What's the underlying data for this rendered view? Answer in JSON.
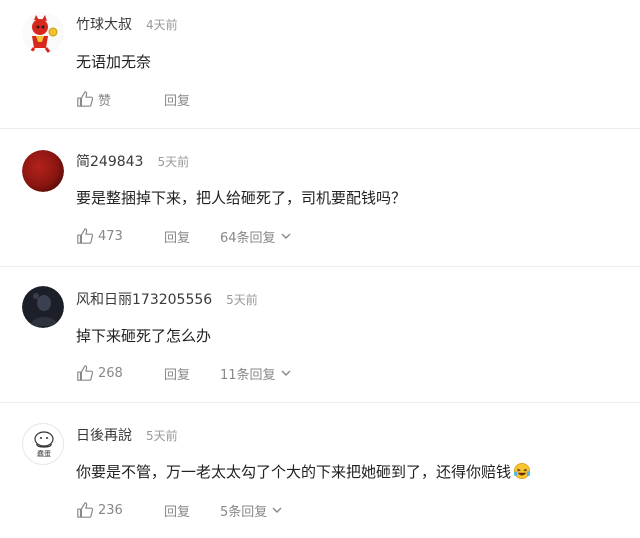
{
  "comments": [
    {
      "user": "竹球大叔",
      "time": "4天前",
      "text": "无语加无奈",
      "likes": "赞",
      "reply_label": "回复",
      "replies": "",
      "avatar_icon": "cartoon-fox-avatar"
    },
    {
      "user": "简249843",
      "time": "5天前",
      "text": "要是整捆掉下来，把人给砸死了，司机要配钱吗？",
      "likes": "473",
      "reply_label": "回复",
      "replies": "64条回复",
      "avatar_icon": "red-circle-avatar"
    },
    {
      "user": "风和日丽173205556",
      "time": "5天前",
      "text": "掉下来砸死了怎么办",
      "likes": "268",
      "reply_label": "回复",
      "replies": "11条回复",
      "avatar_icon": "dark-photo-avatar"
    },
    {
      "user": "日後再說",
      "time": "5天前",
      "text": "你要是不管，万一老太太勾了个大的下来把她砸到了，还得你赔钱",
      "likes": "236",
      "reply_label": "回复",
      "replies": "5条回复",
      "avatar_icon": "doodle-avatar",
      "avatar_caption": "蠢蛋",
      "trailing_emoji": "laughing-tears-emoji"
    }
  ],
  "colors": {
    "name": "#3a3a3a",
    "time": "#999999",
    "action": "#888888",
    "divider": "#ececec"
  }
}
